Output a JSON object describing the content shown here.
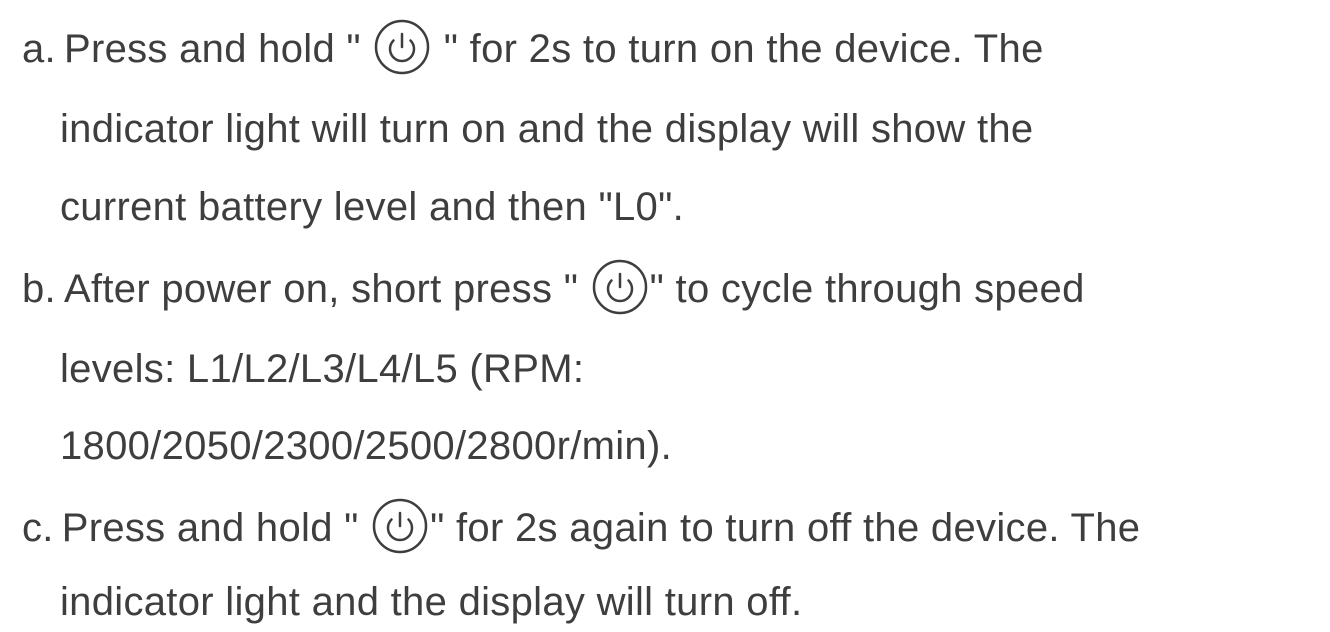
{
  "icon_name": "power-icon",
  "text_color": "#3e3e3e",
  "items": [
    {
      "marker": "a.",
      "pre_icon": "Press and hold \"",
      "post_icon": " \" for 2s to turn on the device. The",
      "continuation": [
        "indicator light will turn on and the display will show the",
        "current battery level and then \"L0\"."
      ]
    },
    {
      "marker": "b.",
      "pre_icon": "After power on, short press \"",
      "post_icon": "\" to cycle through speed",
      "continuation": [
        "levels: L1/L2/L3/L4/L5  (RPM:",
        "1800/2050/2300/2500/2800r/min)."
      ]
    },
    {
      "marker": "c.",
      "pre_icon": "Press and hold \"",
      "post_icon": "\" for 2s again to turn off the device. The",
      "continuation": [
        "indicator light and the display will turn off."
      ]
    }
  ]
}
